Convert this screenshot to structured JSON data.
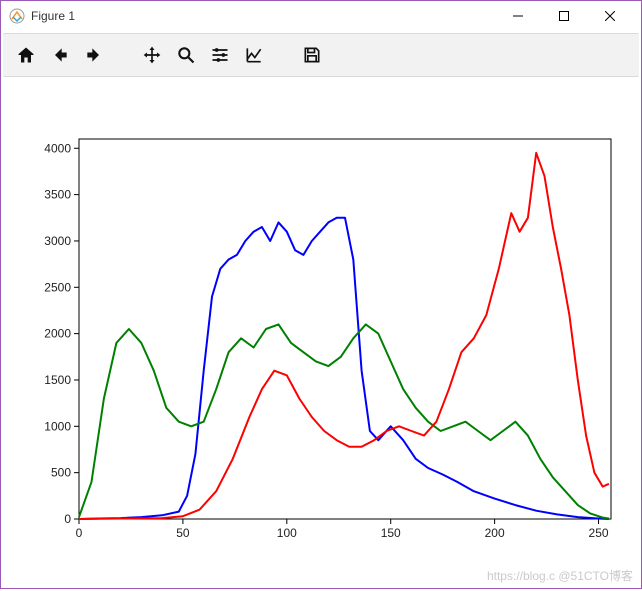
{
  "window": {
    "title": "Figure 1"
  },
  "toolbar": {
    "home": "home-icon",
    "back": "back-icon",
    "forward": "forward-icon",
    "pan": "pan-icon",
    "zoom": "zoom-icon",
    "subplots": "subplots-icon",
    "axes": "axes-icon",
    "save": "save-icon"
  },
  "watermark": "https://blog.c @51CTO博客",
  "chart_data": {
    "type": "line",
    "xlim": [
      0,
      256
    ],
    "ylim": [
      0,
      4100
    ],
    "xticks": [
      0,
      50,
      100,
      150,
      200,
      250
    ],
    "yticks": [
      0,
      500,
      1000,
      1500,
      2000,
      2500,
      3000,
      3500,
      4000
    ],
    "series": [
      {
        "name": "blue",
        "color": "#0000ff",
        "x": [
          0,
          10,
          20,
          30,
          40,
          48,
          52,
          56,
          60,
          64,
          68,
          72,
          76,
          80,
          84,
          88,
          92,
          96,
          100,
          104,
          108,
          112,
          116,
          120,
          124,
          128,
          132,
          136,
          140,
          144,
          150,
          156,
          162,
          168,
          175,
          182,
          190,
          200,
          210,
          220,
          230,
          240,
          250,
          255
        ],
        "values": [
          0,
          5,
          10,
          20,
          40,
          80,
          250,
          700,
          1600,
          2400,
          2700,
          2800,
          2850,
          3000,
          3100,
          3150,
          3000,
          3200,
          3100,
          2900,
          2850,
          3000,
          3100,
          3200,
          3250,
          3250,
          2800,
          1600,
          950,
          850,
          1000,
          850,
          650,
          550,
          480,
          400,
          300,
          220,
          150,
          90,
          50,
          20,
          5,
          0
        ]
      },
      {
        "name": "green",
        "color": "#008000",
        "x": [
          0,
          6,
          12,
          18,
          24,
          30,
          36,
          42,
          48,
          54,
          60,
          66,
          72,
          78,
          84,
          90,
          96,
          102,
          108,
          114,
          120,
          126,
          132,
          138,
          144,
          150,
          156,
          162,
          168,
          174,
          180,
          186,
          192,
          198,
          204,
          210,
          216,
          222,
          228,
          234,
          240,
          246,
          252,
          255
        ],
        "values": [
          20,
          400,
          1300,
          1900,
          2050,
          1900,
          1600,
          1200,
          1050,
          1000,
          1050,
          1400,
          1800,
          1950,
          1850,
          2050,
          2100,
          1900,
          1800,
          1700,
          1650,
          1750,
          1950,
          2100,
          2000,
          1700,
          1400,
          1200,
          1050,
          950,
          1000,
          1050,
          950,
          850,
          950,
          1050,
          900,
          650,
          450,
          300,
          150,
          60,
          15,
          5
        ]
      },
      {
        "name": "red",
        "color": "#ff0000",
        "x": [
          0,
          20,
          40,
          50,
          58,
          66,
          74,
          82,
          88,
          94,
          100,
          106,
          112,
          118,
          124,
          130,
          136,
          142,
          148,
          154,
          160,
          166,
          172,
          178,
          184,
          190,
          196,
          202,
          208,
          212,
          216,
          220,
          224,
          228,
          232,
          236,
          240,
          244,
          248,
          252,
          255
        ],
        "values": [
          0,
          5,
          10,
          30,
          100,
          300,
          650,
          1100,
          1400,
          1600,
          1550,
          1300,
          1100,
          950,
          850,
          780,
          780,
          850,
          950,
          1000,
          950,
          900,
          1050,
          1400,
          1800,
          1950,
          2200,
          2700,
          3300,
          3100,
          3250,
          3950,
          3700,
          3150,
          2700,
          2200,
          1500,
          900,
          500,
          350,
          380
        ]
      }
    ]
  }
}
